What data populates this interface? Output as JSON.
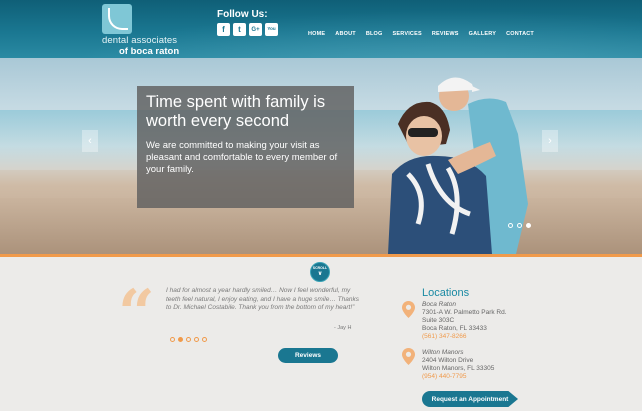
{
  "header": {
    "logo_line1": "dental associates",
    "logo_line2": "of boca raton",
    "follow_label": "Follow Us:",
    "social": [
      {
        "name": "facebook-icon",
        "glyph": "f"
      },
      {
        "name": "twitter-icon",
        "glyph": "t"
      },
      {
        "name": "google-plus-icon",
        "glyph": "G+"
      },
      {
        "name": "youtube-icon",
        "glyph": "You"
      }
    ],
    "nav": [
      "HOME",
      "ABOUT",
      "BLOG",
      "SERVICES",
      "REVIEWS",
      "GALLERY",
      "CONTACT"
    ]
  },
  "hero": {
    "headline": "Time spent with family is worth every second",
    "subtext": "We are committed to making your visit as pleasant and comfortable to every member of your family.",
    "arrow_left": "‹",
    "arrow_right": "›"
  },
  "scroll_label": "SCROLL",
  "testimonial": {
    "text": "I had for almost a year hardly smiled… Now I feel wonderful, my teeth feel natural, I enjoy eating, and I have a huge smile… Thanks to Dr. Michael Costabile. Thank you from the bottom of my heart!”",
    "attribution": "- Jay H",
    "quote_glyph": "“"
  },
  "reviews_button": "Reviews",
  "locations": {
    "title": "Locations",
    "items": [
      {
        "name": "Boca Raton",
        "line1": "7301-A W. Palmetto Park Rd.",
        "line2": "Suite 303C",
        "line3": "Boca Raton, FL 33433",
        "phone": "(561) 347-8266"
      },
      {
        "name": "Wilton Manors",
        "line1": "2404 Wilton Drive",
        "line2": "Wilton Manors, FL 33305",
        "line3": "",
        "phone": "(954) 440-7795"
      }
    ]
  },
  "appointment_button": "Request an Appointment",
  "colors": {
    "brand": "#1a7791",
    "accent": "#f09a4b"
  }
}
